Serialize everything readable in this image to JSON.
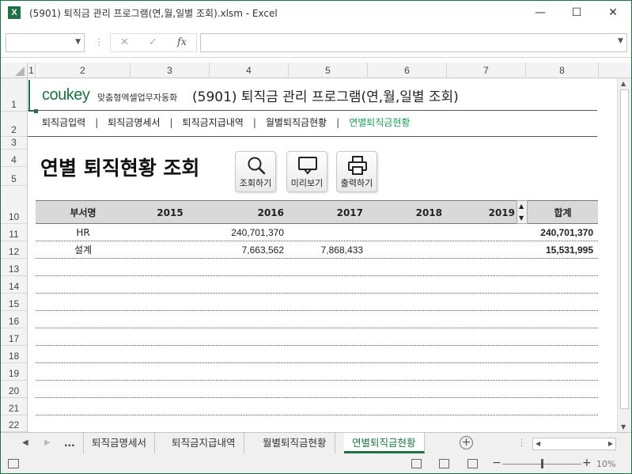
{
  "window": {
    "title": "(5901) 퇴직금 관리 프로그램(연,월,일별 조회).xlsm - Excel",
    "app_icon": "X",
    "minimize": "—",
    "maximize": "☐",
    "close": "✕"
  },
  "formula_bar": {
    "cancel": "✕",
    "enter": "✓",
    "fx": "fx",
    "content": ""
  },
  "columns": [
    "1",
    "2",
    "3",
    "4",
    "5",
    "6",
    "7",
    "8"
  ],
  "rows": [
    "1",
    "2",
    "3",
    "4",
    "5",
    "10",
    "11",
    "12",
    "13",
    "14",
    "15",
    "16",
    "17",
    "18",
    "19",
    "20",
    "21",
    "22"
  ],
  "sheet": {
    "logo": "coukey",
    "logo_sub": "맞춤형엑셀업무자동화",
    "program_title": "(5901) 퇴직금 관리 프로그램(연,월,일별 조회)",
    "nav": [
      {
        "label": "퇴직금입력"
      },
      {
        "label": "퇴직금명세서"
      },
      {
        "label": "퇴직금지급내역"
      },
      {
        "label": "월별퇴직금현황"
      },
      {
        "label": "연별퇴직금현황"
      }
    ],
    "nav_sep": "|",
    "page_title": "연별 퇴직현황 조회",
    "buttons": {
      "search": "조회하기",
      "preview": "미리보기",
      "print": "출력하기"
    },
    "table": {
      "headers": [
        "부서명",
        "2015",
        "2016",
        "2017",
        "2018",
        "2019"
      ],
      "total_header": "합계",
      "rows": [
        {
          "dept": "HR",
          "y2015": "",
          "y2016": "240,701,370",
          "y2017": "",
          "y2018": "",
          "y2019": "",
          "total": "240,701,370"
        },
        {
          "dept": "설계",
          "y2015": "",
          "y2016": "7,663,562",
          "y2017": "7,868,433",
          "y2018": "",
          "y2019": "",
          "total": "15,531,995"
        },
        {
          "dept": "",
          "y2015": "",
          "y2016": "",
          "y2017": "",
          "y2018": "",
          "y2019": "",
          "total": ""
        },
        {
          "dept": "",
          "y2015": "",
          "y2016": "",
          "y2017": "",
          "y2018": "",
          "y2019": "",
          "total": ""
        },
        {
          "dept": "",
          "y2015": "",
          "y2016": "",
          "y2017": "",
          "y2018": "",
          "y2019": "",
          "total": ""
        },
        {
          "dept": "",
          "y2015": "",
          "y2016": "",
          "y2017": "",
          "y2018": "",
          "y2019": "",
          "total": ""
        },
        {
          "dept": "",
          "y2015": "",
          "y2016": "",
          "y2017": "",
          "y2018": "",
          "y2019": "",
          "total": ""
        },
        {
          "dept": "",
          "y2015": "",
          "y2016": "",
          "y2017": "",
          "y2018": "",
          "y2019": "",
          "total": ""
        },
        {
          "dept": "",
          "y2015": "",
          "y2016": "",
          "y2017": "",
          "y2018": "",
          "y2019": "",
          "total": ""
        },
        {
          "dept": "",
          "y2015": "",
          "y2016": "",
          "y2017": "",
          "y2018": "",
          "y2019": "",
          "total": ""
        },
        {
          "dept": "",
          "y2015": "",
          "y2016": "",
          "y2017": "",
          "y2018": "",
          "y2019": "",
          "total": ""
        },
        {
          "dept": "",
          "y2015": "",
          "y2016": "",
          "y2017": "",
          "y2018": "",
          "y2019": "",
          "total": ""
        }
      ]
    }
  },
  "tabs": {
    "ellipsis": "...",
    "items": [
      {
        "label": "퇴직금명세서"
      },
      {
        "label": "퇴직금지급내역"
      },
      {
        "label": "월별퇴직금현황"
      },
      {
        "label": "연별퇴직금현황"
      }
    ],
    "add": "+"
  },
  "status": {
    "zoom_minus": "−",
    "zoom_plus": "+",
    "zoom_level": "10%"
  },
  "colors": {
    "excel_green": "#1e7145",
    "active_nav": "#1e9a55",
    "header_fill": "#d9d9d9"
  },
  "icons": [
    "excel-icon",
    "search-icon",
    "monitor-icon",
    "printer-icon",
    "add-sheet-icon",
    "macro-icon"
  ]
}
